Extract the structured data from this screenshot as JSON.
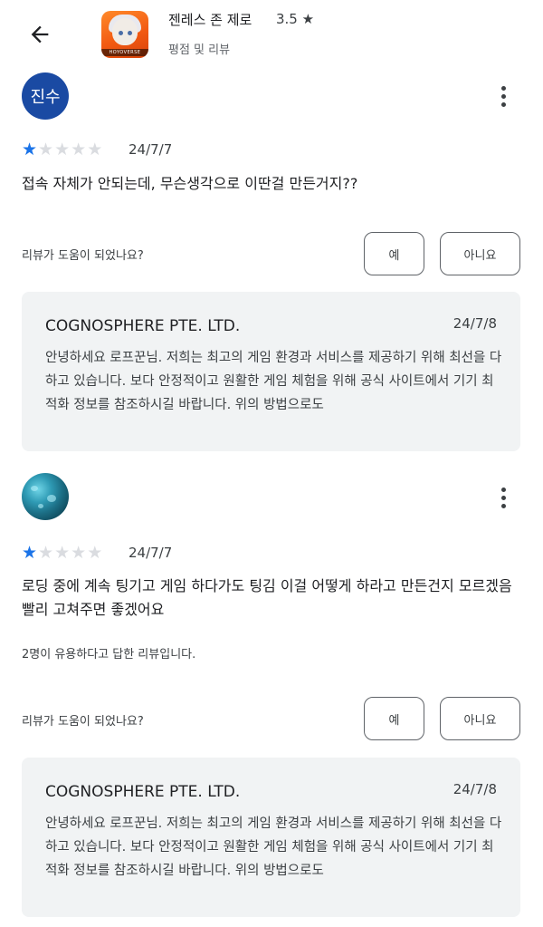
{
  "header": {
    "app_name": "젠레스 존 제로",
    "rating": "3.5 ★",
    "subtitle": "평점 및 리뷰",
    "app_icon_brand": "HOYOVERSE"
  },
  "reviews": [
    {
      "avatar_text": "진수",
      "stars_filled": 1,
      "stars_total": 5,
      "date": "24/7/7",
      "text": "접속 자체가 안되는데, 무슨생각으로 이딴걸 만든거지??",
      "helpful_count": "",
      "helpful_question": "리뷰가 도움이 되었나요?",
      "yes_label": "예",
      "no_label": "아니요",
      "reply": {
        "developer": "COGNOSPHERE PTE. LTD.",
        "date": "24/7/8",
        "text": "안녕하세요 로프꾼님. 저희는 최고의 게임 환경과 서비스를 제공하기 위해 최선을 다하고 있습니다. 보다 안정적이고 원활한 게임 체험을 위해 공식 사이트에서 기기 최적화 정보를 참조하시길 바랍니다. 위의 방법으로도"
      }
    },
    {
      "avatar_text": "",
      "stars_filled": 1,
      "stars_total": 5,
      "date": "24/7/7",
      "text": "로딩 중에 계속 팅기고 게임 하다가도 팅김 이걸 어떻게 하라고 만든건지 모르겠음 빨리 고쳐주면 좋겠어요",
      "helpful_count": "2명이 유용하다고 답한 리뷰입니다.",
      "helpful_question": "리뷰가 도움이 되었나요?",
      "yes_label": "예",
      "no_label": "아니요",
      "reply": {
        "developer": "COGNOSPHERE PTE. LTD.",
        "date": "24/7/8",
        "text": "안녕하세요 로프꾼님. 저희는 최고의 게임 환경과 서비스를 제공하기 위해 최선을 다하고 있습니다. 보다 안정적이고 원활한 게임 체험을 위해 공식 사이트에서 기기 최적화 정보를 참조하시길 바랍니다. 위의 방법으로도"
      }
    }
  ],
  "colors": {
    "star_filled": "#1a73e8",
    "star_empty": "#dadce0",
    "avatar_bg": "#1a4aa3",
    "reply_bg": "#f1f3f4"
  },
  "icons": {
    "back": "arrow-back-icon",
    "more": "more-vert-icon",
    "star": "star-icon"
  }
}
